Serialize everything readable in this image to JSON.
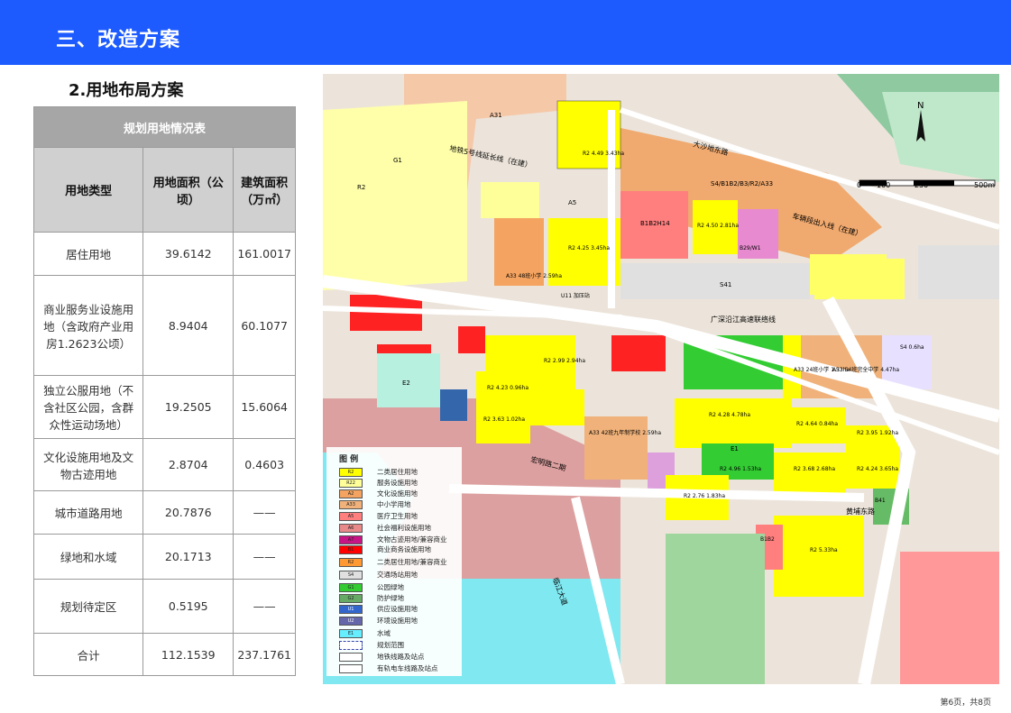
{
  "header": {
    "title": "三、改造方案"
  },
  "section": {
    "subtitle": "2.用地布局方案"
  },
  "table": {
    "caption": "规划用地情况表",
    "columns": [
      "用地类型",
      "用地面积（公顷）",
      "建筑面积（万㎡）"
    ],
    "rows": [
      {
        "type": "居住用地",
        "area": "39.6142",
        "floor": "161.0017"
      },
      {
        "type": "商业服务业设施用地（含政府产业用房1.2623公顷）",
        "area": "8.9404",
        "floor": "60.1077"
      },
      {
        "type": "独立公服用地（不含社区公园，含群众性运动场地）",
        "area": "19.2505",
        "floor": "15.6064"
      },
      {
        "type": "文化设施用地及文物古迹用地",
        "area": "2.8704",
        "floor": "0.4603"
      },
      {
        "type": "城市道路用地",
        "area": "20.7876",
        "floor": "——"
      },
      {
        "type": "绿地和水域",
        "area": "20.1713",
        "floor": "——"
      },
      {
        "type": "规划待定区",
        "area": "0.5195",
        "floor": "——"
      },
      {
        "type": "合计",
        "area": "112.1539",
        "floor": "237.1761"
      }
    ]
  },
  "map": {
    "north": "N",
    "scale": [
      "0",
      "100",
      "250",
      "500m"
    ],
    "roads": [
      "大沙地东路",
      "车辆段出入线（在建）",
      "地铁5号线延长线（在建）",
      "广深沿江高速联络线",
      "黄埔东路",
      "临江大道",
      "宏明路二期"
    ],
    "labels": [
      {
        "code": "A31"
      },
      {
        "code": "G1"
      },
      {
        "code": "R2"
      },
      {
        "code": "A5"
      },
      {
        "code": "B1B2H14"
      },
      {
        "code": "S4/B1B2/B3/R2/A33"
      },
      {
        "code": "R2\n4.49\n3.43ha"
      },
      {
        "code": "R2\n4.50\n2.81ha"
      },
      {
        "code": "B29/W1"
      },
      {
        "code": "S41"
      },
      {
        "code": "U11\n加压站"
      },
      {
        "code": "A33\n48班小学\n2.59ha"
      },
      {
        "code": "R2\n4.25\n3.45ha"
      },
      {
        "code": "S4\n0.6ha"
      },
      {
        "code": "A33\n24班小学\n1.53ha"
      },
      {
        "code": "A33\n54班完全中学\n4.47ha"
      },
      {
        "code": "R2\n4.28\n4.78ha"
      },
      {
        "code": "R2\n4.64\n0.84ha"
      },
      {
        "code": "R2\n3.95\n1.92ha"
      },
      {
        "code": "R2\n4.96\n1.53ha"
      },
      {
        "code": "R2\n3.68\n2.68ha"
      },
      {
        "code": "R2\n4.24\n3.65ha"
      },
      {
        "code": "R2\n5.33ha"
      },
      {
        "code": "R2\n2.76\n1.83ha"
      },
      {
        "code": "E1"
      },
      {
        "code": "E2"
      },
      {
        "code": "B41"
      },
      {
        "code": "B1B2"
      },
      {
        "code": "A33\n42班九年制学校\n2.59ha"
      },
      {
        "code": "R2\n4.23\n0.96ha"
      },
      {
        "code": "R2\n3.63\n1.02ha"
      },
      {
        "code": "R2\n2.99\n2.94ha"
      }
    ]
  },
  "legend": {
    "title": "图  例",
    "items": [
      {
        "code": "R2",
        "label": "二类居住用地",
        "color": "#ffff00"
      },
      {
        "code": "R22",
        "label": "服务设施用地",
        "color": "#ffff99"
      },
      {
        "code": "A2",
        "label": "文化设施用地",
        "color": "#f4a460"
      },
      {
        "code": "A33",
        "label": "中小学用地",
        "color": "#f0b27a"
      },
      {
        "code": "A5",
        "label": "医疗卫生用地",
        "color": "#ff7f7f"
      },
      {
        "code": "A6",
        "label": "社会福利设施用地",
        "color": "#e88a8a"
      },
      {
        "code": "A7",
        "label": "文物古迹用地/兼容商业",
        "color": "#c71585"
      },
      {
        "code": "B1",
        "label": "商业商务设施用地",
        "color": "#ff0000"
      },
      {
        "code": "R2",
        "label": "二类居住用地/兼容商业",
        "color": "#ff9933"
      },
      {
        "code": "S4",
        "label": "交通场站用地",
        "color": "#e0e0e0"
      },
      {
        "code": "G1",
        "label": "公园绿地",
        "color": "#33cc33"
      },
      {
        "code": "G2",
        "label": "防护绿地",
        "color": "#66aa66"
      },
      {
        "code": "U1",
        "label": "供应设施用地",
        "color": "#3366cc"
      },
      {
        "code": "U2",
        "label": "环境设施用地",
        "color": "#6666aa"
      },
      {
        "code": "E1",
        "label": "水域",
        "color": "#66eeff"
      },
      {
        "code": "",
        "label": "规划范围",
        "color": "#ffffff"
      },
      {
        "code": "",
        "label": "地铁线路及站点",
        "color": "#ffffff"
      },
      {
        "code": "",
        "label": "有轨电车线路及站点",
        "color": "#ffffff"
      }
    ]
  },
  "footer": {
    "page": "第6页，共8页"
  },
  "colors": {
    "banner": "#1e5bff",
    "table_caption": "#a6a6a6",
    "table_header": "#d0d0d0"
  }
}
